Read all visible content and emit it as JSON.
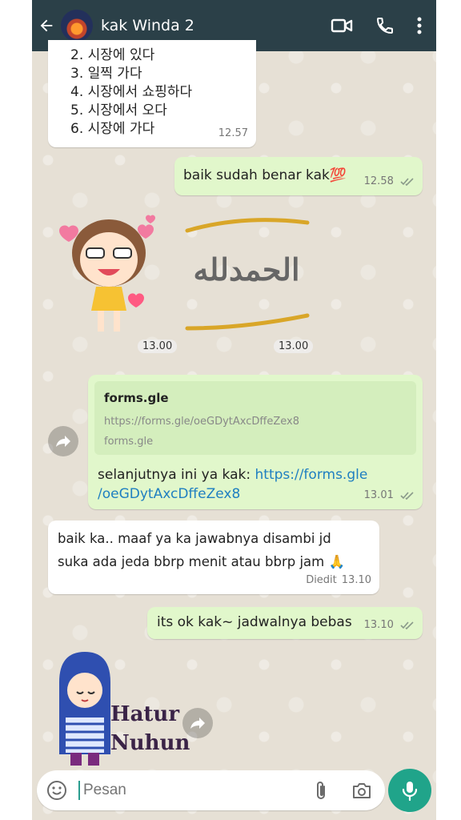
{
  "header": {
    "title": "kak Winda 2"
  },
  "messages": {
    "korean": {
      "lines": [
        "2. 시장에 있다",
        "3. 일찍 가다",
        "4. 시장에서 쇼핑하다",
        "5. 시장에서 오다",
        "6. 시장에 가다"
      ],
      "time": "12.57"
    },
    "reply1": {
      "text": "baik sudah benar kak💯",
      "time": "12.58"
    },
    "sticker_times": [
      "13.00",
      "13.00"
    ],
    "link_msg": {
      "preview_title": "forms.gle",
      "preview_url": "https://forms.gle/oeGDytAxcDffeZex8",
      "preview_domain": "forms.gle",
      "text_prefix": "selanjutnya ini ya kak: ",
      "link_line1": "https://forms.gle",
      "link_line2": "/oeGDytAxcDffeZex8",
      "time": "13.01"
    },
    "incoming2": {
      "line1": "baik ka.. maaf ya ka jawabnya disambi jd",
      "line2": "suka ada jeda bbrp menit atau bbrp jam 🙏",
      "edited": "Diedit",
      "time": "13.10"
    },
    "reply2": {
      "text": "its ok kak~ jadwalnya bebas",
      "time": "13.10"
    },
    "sticker2_text": [
      "Hatur",
      "Nuhun"
    ],
    "sticker1_text": "الحمدلله"
  },
  "input": {
    "placeholder": "Pesan"
  },
  "colors": {
    "header": "#2b4048",
    "outgoing": "#e1f7cb",
    "link": "#1f7fc1",
    "mic": "#20a48a"
  }
}
